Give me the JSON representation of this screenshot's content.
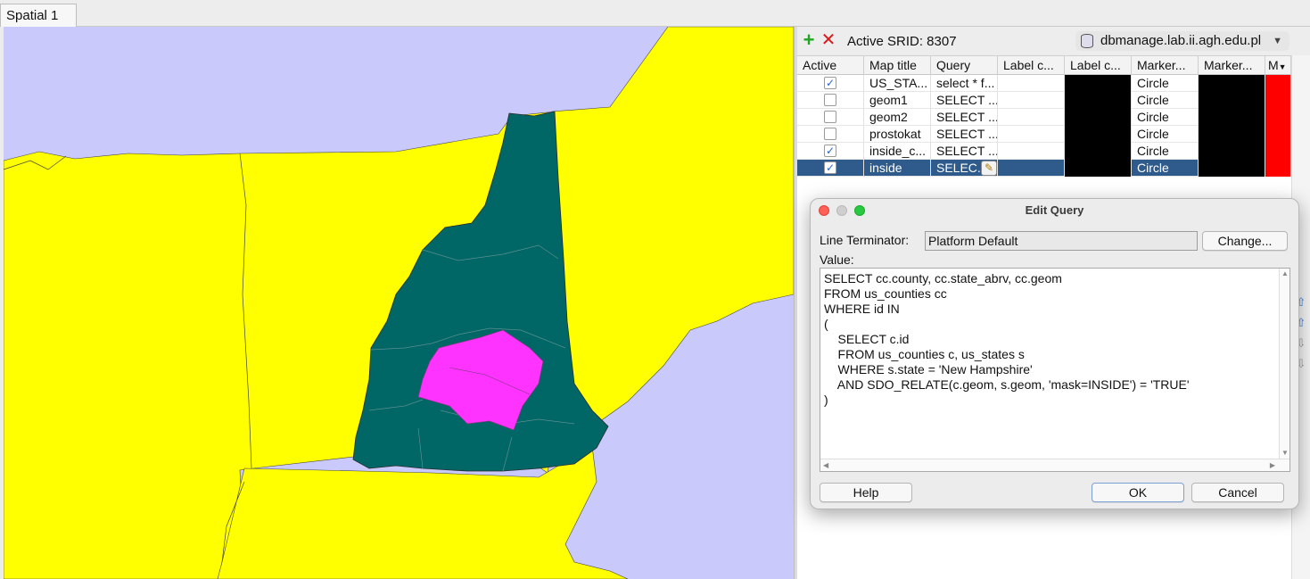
{
  "tab": {
    "label": "Spatial 1"
  },
  "toolbar": {
    "active_srid": "Active SRID: 8307",
    "connection": "dbmanage.lab.ii.agh.edu.pl"
  },
  "table": {
    "headers": [
      "Active",
      "Map title",
      "Query",
      "Label c...",
      "Label c...",
      "Marker...",
      "Marker...",
      "M"
    ],
    "rows": [
      {
        "active": true,
        "title": "US_STA...",
        "query": "select * f...",
        "marker": "Circle"
      },
      {
        "active": false,
        "title": "geom1",
        "query": "SELECT ...",
        "marker": "Circle"
      },
      {
        "active": false,
        "title": "geom2",
        "query": "SELECT ...",
        "marker": "Circle"
      },
      {
        "active": false,
        "title": "prostokat",
        "query": "SELECT  ...",
        "marker": "Circle"
      },
      {
        "active": true,
        "title": "inside_c...",
        "query": "SELECT ...",
        "marker": "Circle"
      },
      {
        "active": true,
        "title": "inside",
        "query": "SELEC...",
        "marker": "Circle"
      }
    ]
  },
  "dialog": {
    "title": "Edit Query",
    "line_terminator_label": "Line Terminator:",
    "line_terminator_value": "Platform Default",
    "change_button": "Change...",
    "value_label": "Value:",
    "query_text": "SELECT cc.county, cc.state_abrv, cc.geom\nFROM us_counties cc\nWHERE id IN\n(\n    SELECT c.id\n    FROM us_counties c, us_states s\n    WHERE s.state = 'New Hampshire'\n    AND SDO_RELATE(c.geom, s.geom, 'mask=INSIDE') = 'TRUE'\n)",
    "help_button": "Help",
    "ok_button": "OK",
    "cancel_button": "Cancel"
  },
  "colors": {
    "water": "#c9c9fb",
    "land": "#ffff00",
    "state_fill": "#006666",
    "inside_fill": "#ff33ff",
    "selection": "#2e5a8c"
  },
  "icons": {
    "add": "plus-icon",
    "delete": "x-icon",
    "connection": "database-icon",
    "edit": "pencil-icon"
  }
}
